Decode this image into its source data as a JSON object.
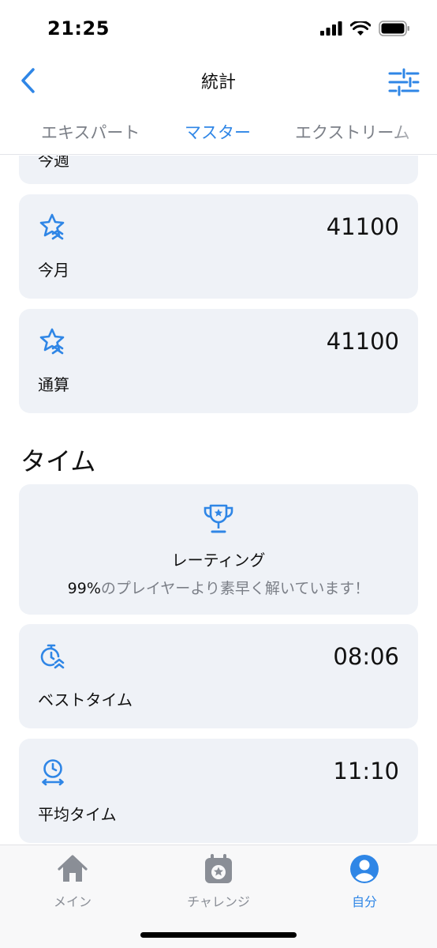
{
  "status_bar": {
    "time": "21:25"
  },
  "nav": {
    "title": "統計",
    "back_icon": "chevron-left-icon",
    "filter_icon": "sliders-icon"
  },
  "tabs": [
    {
      "label": "エキスパート",
      "active": false
    },
    {
      "label": "マスター",
      "active": true
    },
    {
      "label": "エクストリーム",
      "active": false
    }
  ],
  "score_cards": {
    "partial_label": "今週",
    "month": {
      "label": "今月",
      "value": "41100",
      "icon": "star-rank-icon"
    },
    "total": {
      "label": "通算",
      "value": "41100",
      "icon": "star-rank-icon"
    }
  },
  "time_section": {
    "title": "タイム",
    "rating": {
      "icon": "trophy-icon",
      "title": "レーティング",
      "percent": "99%",
      "text": "のプレイヤーより素早く解いています！"
    },
    "best": {
      "label": "ベストタイム",
      "value": "08:06",
      "icon": "stopwatch-icon"
    },
    "average": {
      "label": "平均タイム",
      "value": "11:10",
      "icon": "average-clock-icon"
    }
  },
  "tab_bar": [
    {
      "label": "メイン",
      "icon": "home-icon",
      "active": false
    },
    {
      "label": "チャレンジ",
      "icon": "calendar-star-icon",
      "active": false
    },
    {
      "label": "自分",
      "icon": "profile-icon",
      "active": true
    }
  ],
  "colors": {
    "accent": "#2f86e6",
    "card": "#eff2f7",
    "muted": "#7b7f87"
  }
}
